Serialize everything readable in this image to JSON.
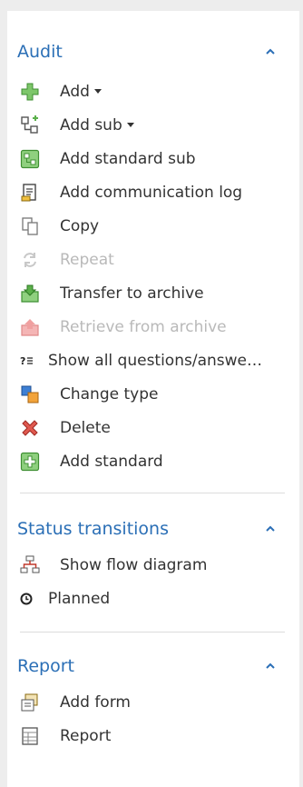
{
  "sections": {
    "audit": {
      "title": "Audit",
      "items": [
        {
          "label": "Add",
          "icon": "plus-cross-icon",
          "disabled": false,
          "has_dropdown": true
        },
        {
          "label": "Add sub",
          "icon": "hierarchy-icon",
          "disabled": false,
          "has_dropdown": true
        },
        {
          "label": "Add standard sub",
          "icon": "standard-sub-icon",
          "disabled": false
        },
        {
          "label": "Add communication log",
          "icon": "log-document-icon",
          "disabled": false
        },
        {
          "label": "Copy",
          "icon": "copy-icon",
          "disabled": false
        },
        {
          "label": "Repeat",
          "icon": "repeat-icon",
          "disabled": true
        },
        {
          "label": "Transfer to archive",
          "icon": "archive-in-icon",
          "disabled": false
        },
        {
          "label": "Retrieve from archive",
          "icon": "archive-out-icon",
          "disabled": true
        },
        {
          "label": "Show all questions/answe…",
          "icon": "questions-icon",
          "disabled": false
        },
        {
          "label": "Change type",
          "icon": "change-type-icon",
          "disabled": false
        },
        {
          "label": "Delete",
          "icon": "delete-icon",
          "disabled": false
        },
        {
          "label": "Add standard",
          "icon": "add-standard-icon",
          "disabled": false
        }
      ]
    },
    "status": {
      "title": "Status transitions",
      "items": [
        {
          "label": "Show flow diagram",
          "icon": "flow-diagram-icon",
          "disabled": false
        },
        {
          "label": "Planned",
          "icon": "clock-icon",
          "disabled": false
        }
      ]
    },
    "report": {
      "title": "Report",
      "items": [
        {
          "label": "Add form",
          "icon": "add-form-icon",
          "disabled": false
        },
        {
          "label": "Report",
          "icon": "report-icon",
          "disabled": false
        }
      ]
    }
  },
  "colors": {
    "section_title": "#2b6fb6",
    "text": "#333333",
    "disabled_text": "#b9b9b9",
    "green_icon": "#5bb04a",
    "red_icon": "#d9534f"
  }
}
